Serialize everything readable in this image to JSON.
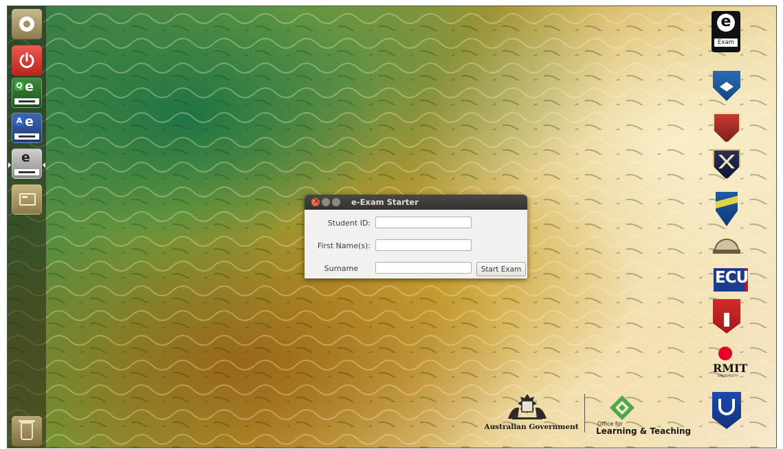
{
  "dialog": {
    "title": "e-Exam Starter",
    "fields": [
      {
        "label": "Student ID:",
        "value": ""
      },
      {
        "label": "First Name(s):",
        "value": ""
      },
      {
        "label": "Surname",
        "value": ""
      }
    ],
    "start_button": "Start Exam"
  },
  "launcher": {
    "items": [
      {
        "name": "dash-home",
        "icon": "ubuntu-dash-icon"
      },
      {
        "name": "shutdown",
        "icon": "power-icon"
      },
      {
        "name": "question-exam-app",
        "icon": "e-exam-icon",
        "letter": "Q",
        "badge": "e"
      },
      {
        "name": "answer-exam-app",
        "icon": "e-exam-icon",
        "letter": "A",
        "badge": "e"
      },
      {
        "name": "e-exam-app",
        "icon": "e-exam-icon",
        "badge": "e"
      },
      {
        "name": "window-app",
        "icon": "window-icon"
      },
      {
        "name": "trash",
        "icon": "trash-icon"
      }
    ]
  },
  "desktop": {
    "eexam_logo": {
      "letter": "e",
      "word": "Exam"
    },
    "logos": [
      {
        "name": "university-shield-blue-logo"
      },
      {
        "name": "university-crest-red-logo"
      },
      {
        "name": "university-crest-navy-logo"
      },
      {
        "name": "university-shield-yellow-blue-logo"
      },
      {
        "name": "university-dome-logo"
      },
      {
        "name": "ecu-logo",
        "text": "ECU"
      },
      {
        "name": "university-red-tower-logo"
      },
      {
        "name": "rmit-logo",
        "text": "RMIT",
        "sub": "UNIVERSITY"
      },
      {
        "name": "university-blue-u-logo"
      }
    ],
    "footer": {
      "australian_government": "Australian Government",
      "olt_line1": "Office for",
      "olt_line2": "Learning & Teaching"
    }
  },
  "colors": {
    "dialog_titlebar": "#3e3d39",
    "close_button": "#e1582b",
    "launcher_background": "#2a2012",
    "rmit_red": "#e60028",
    "ecu_blue": "#1d3c8d",
    "olt_green": "#4ea84a"
  }
}
